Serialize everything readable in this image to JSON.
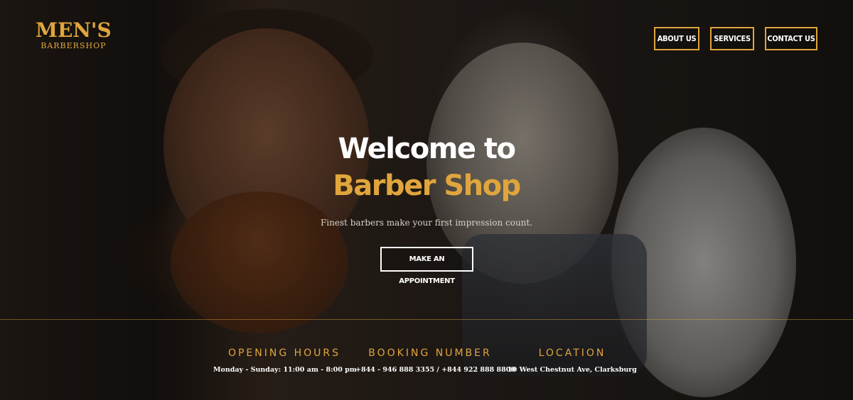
{
  "brand": {
    "name": "MEN'S",
    "subtitle": "BARBERSHOP"
  },
  "nav": {
    "items": [
      {
        "label": "ABOUT US"
      },
      {
        "label": "SERVICES"
      },
      {
        "label": "CONTACT US"
      }
    ]
  },
  "hero": {
    "line1": "Welcome to",
    "line2": "Barber Shop",
    "tagline": "Finest barbers make your first impression count.",
    "cta_label": "MAKE AN APPOINTMENT"
  },
  "info": {
    "hours": {
      "title": "OPENING HOURS",
      "value": "Monday - Sunday: 11:00 am - 8:00 pm"
    },
    "booking": {
      "title": "BOOKING NUMBER",
      "value": "+844 - 946 888 3355 / +844 922 888 8800"
    },
    "location": {
      "title": "LOCATION",
      "value": "10 West Chestnut Ave, Clarksburg"
    }
  },
  "colors": {
    "accent": "#e0a53c",
    "text": "#ffffff"
  }
}
